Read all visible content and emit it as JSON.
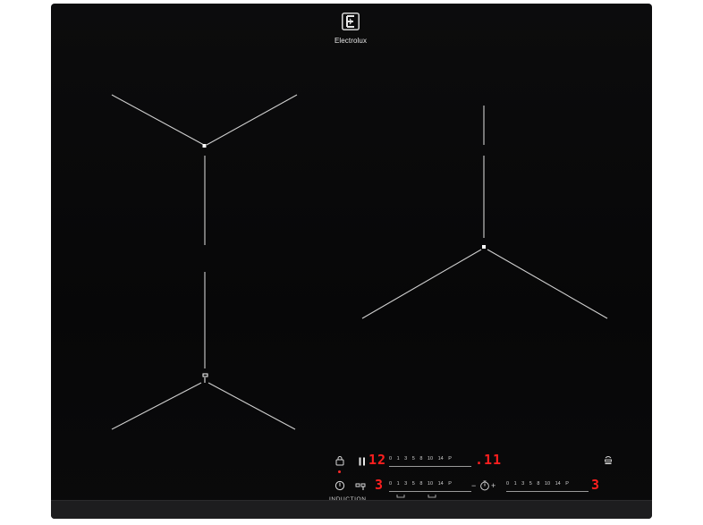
{
  "brand": {
    "name": "Electrolux",
    "logo_icon": "electrolux-logo-icon"
  },
  "controls": {
    "lock_icon": "lock-icon",
    "power_icon": "power-icon",
    "pause_icon": "pause-icon",
    "bridge_icon": "bridge-icon",
    "timer_icon": "timer-icon",
    "hob2hood_icon": "hob2hood-icon",
    "induction_label": "INDUCTION",
    "zone_top_level": "12",
    "zone_top_timer": ".11",
    "zone_bottom_left_level": "3",
    "zone_right_level": "3",
    "timer_minus": "−",
    "timer_plus": "+",
    "scale_top": "0 1 3 5 8 10 14 P",
    "scale_bottom_left": "0 1 3 5 8 10 14 P",
    "scale_bottom_right": "0 1 3 5 8 10 14 P"
  },
  "colors": {
    "glass": "#0a0a0b",
    "display_red": "#ff1f1f",
    "marking_line": "#cfcfcf",
    "frame": "#1d1d1f"
  }
}
